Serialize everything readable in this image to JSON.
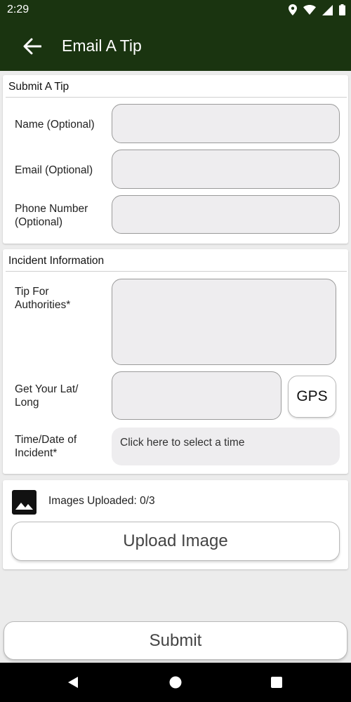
{
  "status_bar": {
    "time": "2:29",
    "icons": [
      "location-icon",
      "wifi-icon",
      "signal-icon",
      "battery-icon"
    ]
  },
  "app_bar": {
    "title": "Email A Tip",
    "back_icon": "arrow-back-icon"
  },
  "submit_section": {
    "title": "Submit A Tip",
    "name_label": "Name (Optional)",
    "email_label": "Email (Optional)",
    "phone_label": "Phone Number (Optional)",
    "name_value": "",
    "email_value": "",
    "phone_value": ""
  },
  "incident_section": {
    "title": "Incident Information",
    "tip_label": "Tip For Authorities*",
    "tip_value": "",
    "latlong_label": "Get Your Lat/ Long",
    "latlong_value": "",
    "gps_label": "GPS",
    "time_label": "Time/Date of Incident*",
    "time_placeholder": "Click here to select a time"
  },
  "images_section": {
    "icon": "image-icon",
    "count_text": "Images Uploaded: 0/3",
    "upload_label": "Upload Image"
  },
  "submit_label": "Submit",
  "nav_bar": {
    "icons": [
      "back-triangle-icon",
      "home-circle-icon",
      "recents-square-icon"
    ]
  },
  "colors": {
    "app_bar": "#1a3410",
    "background": "#ececec",
    "field": "#eeedef"
  }
}
